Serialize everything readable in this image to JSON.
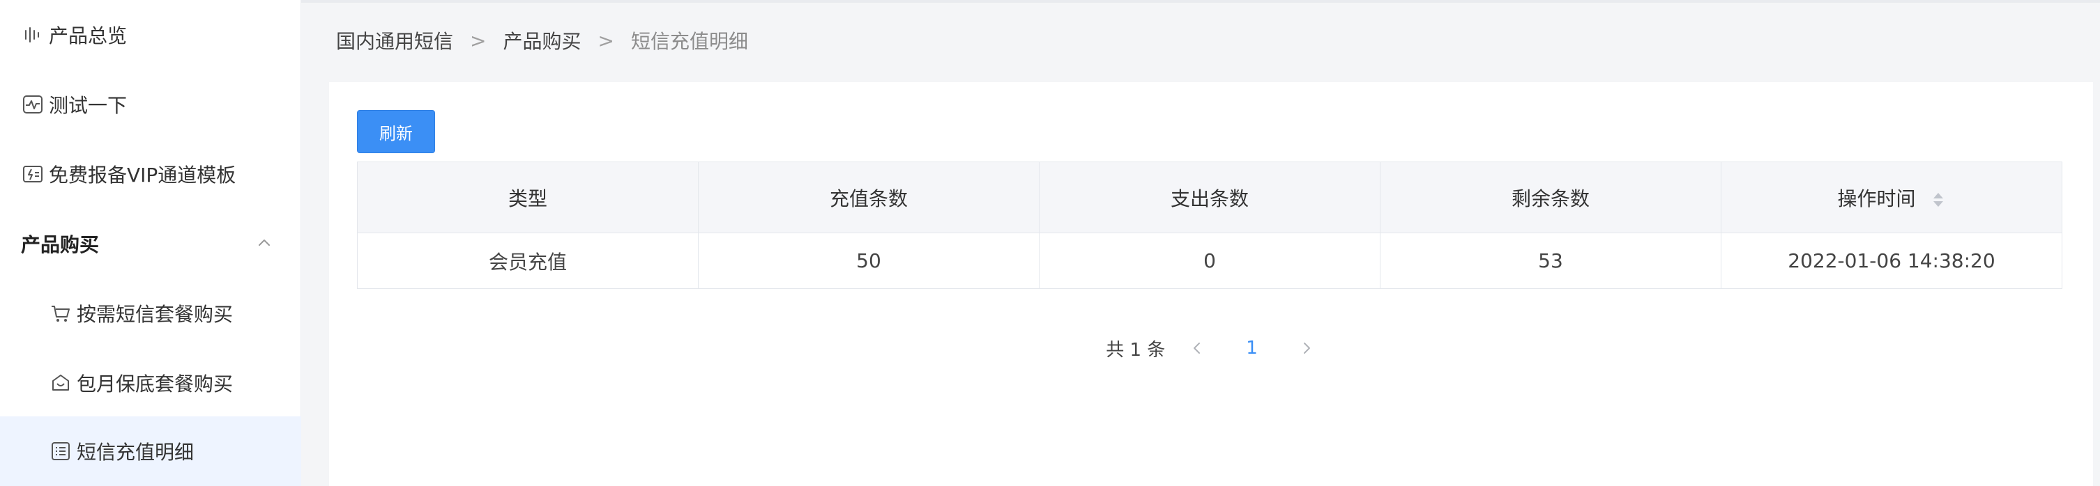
{
  "sidebar": {
    "items": [
      {
        "label": "产品总览",
        "icon": "chart-bars-icon"
      },
      {
        "label": "测试一下",
        "icon": "pulse-icon"
      },
      {
        "label": "免费报备VIP通道模板",
        "icon": "flash-card-icon"
      },
      {
        "label": "产品购买",
        "icon": "chevron-up-icon"
      },
      {
        "label": "按需短信套餐购买",
        "icon": "cart-icon"
      },
      {
        "label": "包月保底套餐购买",
        "icon": "bag-icon"
      },
      {
        "label": "短信充值明细",
        "icon": "list-document-icon"
      }
    ],
    "active_color": "#eef4ff"
  },
  "breadcrumb": {
    "items": [
      "国内通用短信",
      "产品购买",
      "短信充值明细"
    ],
    "separator": ">"
  },
  "toolbar": {
    "refresh_label": "刷新"
  },
  "table": {
    "columns": [
      "类型",
      "充值条数",
      "支出条数",
      "剩余条数",
      "操作时间"
    ],
    "rows": [
      [
        "会员充值",
        "50",
        "0",
        "53",
        "2022-01-06 14:38:20"
      ]
    ]
  },
  "pagination": {
    "total_text": "共 1 条",
    "current_page": "1"
  },
  "colors": {
    "accent": "#3b8ff5"
  }
}
